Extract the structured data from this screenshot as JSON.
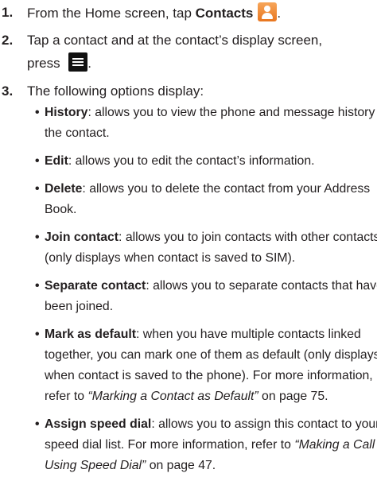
{
  "steps": [
    {
      "num": "1.",
      "pre": "From the Home screen, tap ",
      "bold": "Contacts",
      "icon": "contacts-icon"
    },
    {
      "num": "2.",
      "line1": "Tap a contact and at the contact’s display screen,",
      "line2": "press ",
      "icon": "menu-icon",
      "after": "."
    },
    {
      "num": "3.",
      "text": "The following options display:"
    }
  ],
  "bullets": [
    {
      "bold": "History",
      "l1": ": allows you to view the phone and message history for",
      "l2": "the contact."
    },
    {
      "bold": "Edit",
      "l1": ": allows you to edit the contact’s information."
    },
    {
      "bold": "Delete",
      "l1": ": allows you to delete the contact from your Address",
      "l2": "Book."
    },
    {
      "bold": "Join contact",
      "l1": ": allows you to join contacts with other contacts",
      "l2": "(only displays when contact is saved to SIM)."
    },
    {
      "bold": "Separate contact",
      "l1": ": allows you to separate contacts that have",
      "l2": "been joined."
    },
    {
      "bold": "Mark as default",
      "l1": ": when you have multiple contacts linked",
      "l2": "together, you can mark one of them as default (only displays",
      "l3": "when contact is saved to the phone). For more information,",
      "l4a": "refer to ",
      "l4i": "“Marking a Contact as Default”",
      "l4b": " on page 75."
    },
    {
      "bold": "Assign speed dial",
      "l1": ": allows you to assign this contact to your",
      "l2a": "speed dial list. For more information, refer to ",
      "l2i": "“Making a Call",
      "l3i": "Using Speed Dial”",
      "l3b": " on page 47."
    }
  ]
}
